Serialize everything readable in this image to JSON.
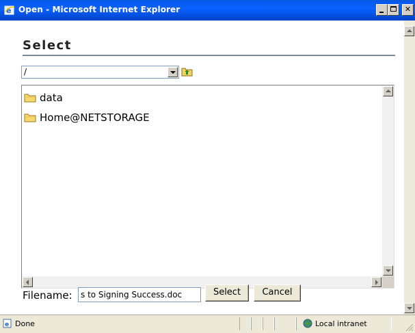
{
  "window": {
    "title": "Open - Microsoft Internet Explorer",
    "title_bar_color": "#0b61ff"
  },
  "dialog": {
    "heading": "Select",
    "path": {
      "value": "/"
    },
    "items": [
      {
        "label": "data",
        "icon": "folder-icon"
      },
      {
        "label": "Home@NETSTORAGE",
        "icon": "folder-icon"
      }
    ],
    "filename": {
      "label": "Filename:",
      "value": "s to Signing Success.doc"
    },
    "buttons": {
      "select": "Select",
      "cancel": "Cancel"
    }
  },
  "status": {
    "text": "Done",
    "zone": "Local intranet"
  }
}
